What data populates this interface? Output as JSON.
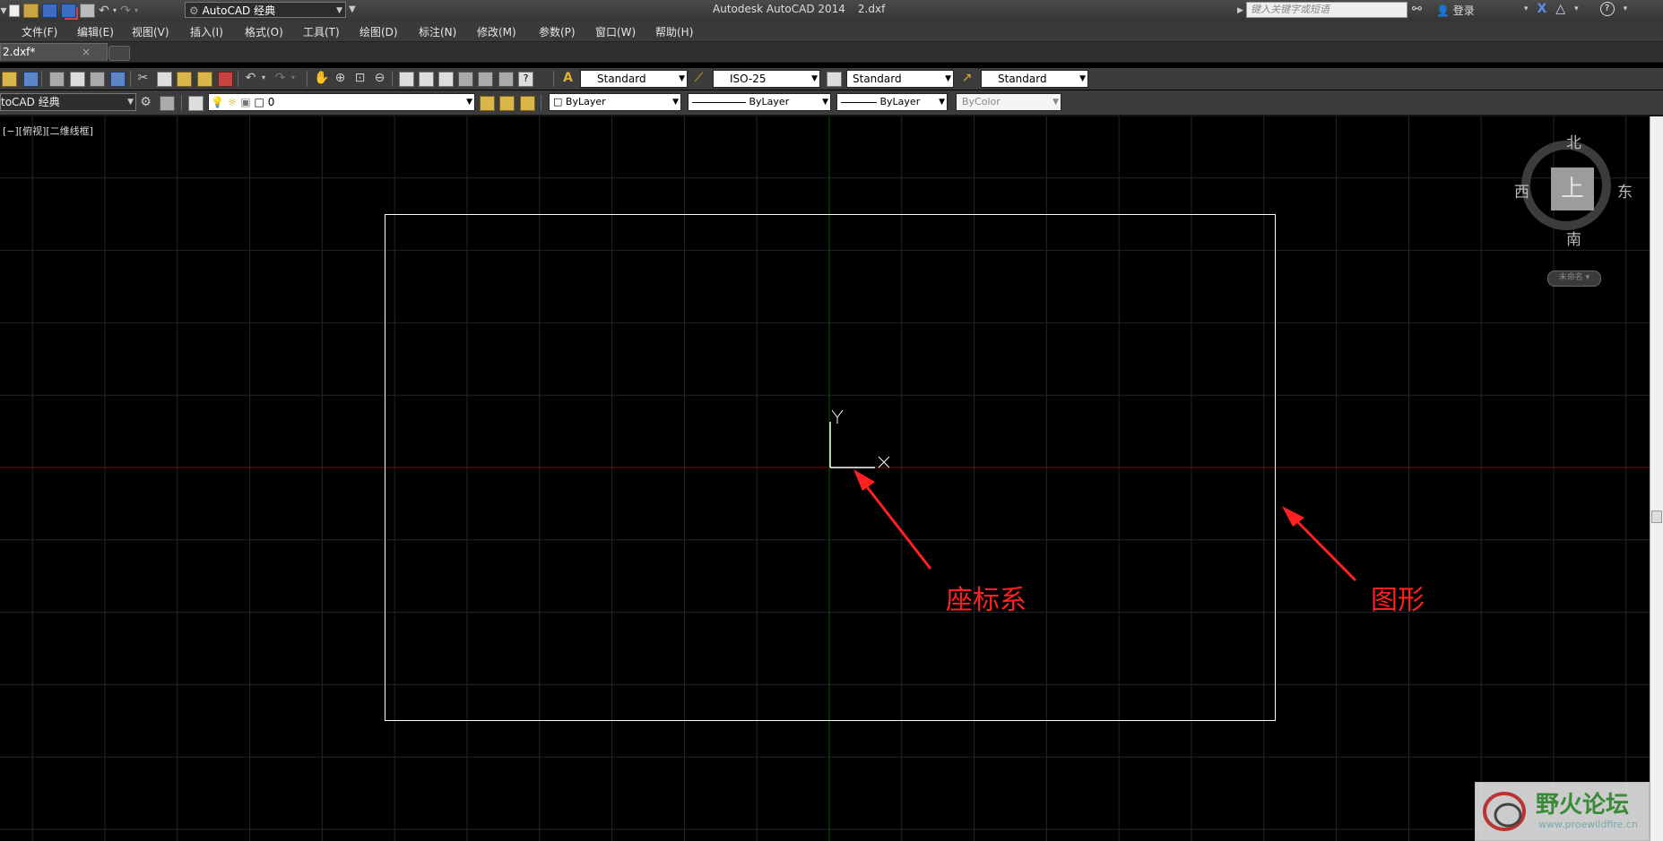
{
  "app": {
    "title": "Autodesk AutoCAD 2014",
    "document": "2.dxf",
    "workspace": "AutoCAD 经典",
    "search_placeholder": "键入关键字或短语",
    "login_label": "登录",
    "help_label": "?"
  },
  "menu": [
    "文件(F)",
    "编辑(E)",
    "视图(V)",
    "插入(I)",
    "格式(O)",
    "工具(T)",
    "绘图(D)",
    "标注(N)",
    "修改(M)",
    "参数(P)",
    "窗口(W)",
    "帮助(H)"
  ],
  "tabs": {
    "active": "2.dxf*",
    "close": "×"
  },
  "toolbar_styles": {
    "text_style": "Standard",
    "dim_style": "ISO-25",
    "table_style": "Standard",
    "mleader_style": "Standard"
  },
  "toolbar_layers": {
    "workspace": "toCAD 经典",
    "layer": "0",
    "color": "ByLayer",
    "linetype": "ByLayer",
    "lineweight": "ByLayer",
    "plotstyle": "ByColor"
  },
  "viewport": {
    "label": "[−][俯视][二维线框]"
  },
  "ucs": {
    "y_label": "Y",
    "x_label": "X"
  },
  "viewcube": {
    "north": "北",
    "south": "南",
    "east": "东",
    "west": "西",
    "face": "上",
    "ucs_menu": "未命名"
  },
  "annotations": {
    "coordinate_system": "座标系",
    "shape": "图形",
    "color": "#ff2020"
  },
  "watermark": {
    "title": "野火论坛",
    "url": "www.proewildfire.cn"
  },
  "colors": {
    "background": "#000000",
    "grid": "#1f2530",
    "x_axis": "#a00000",
    "y_axis": "#006000"
  }
}
